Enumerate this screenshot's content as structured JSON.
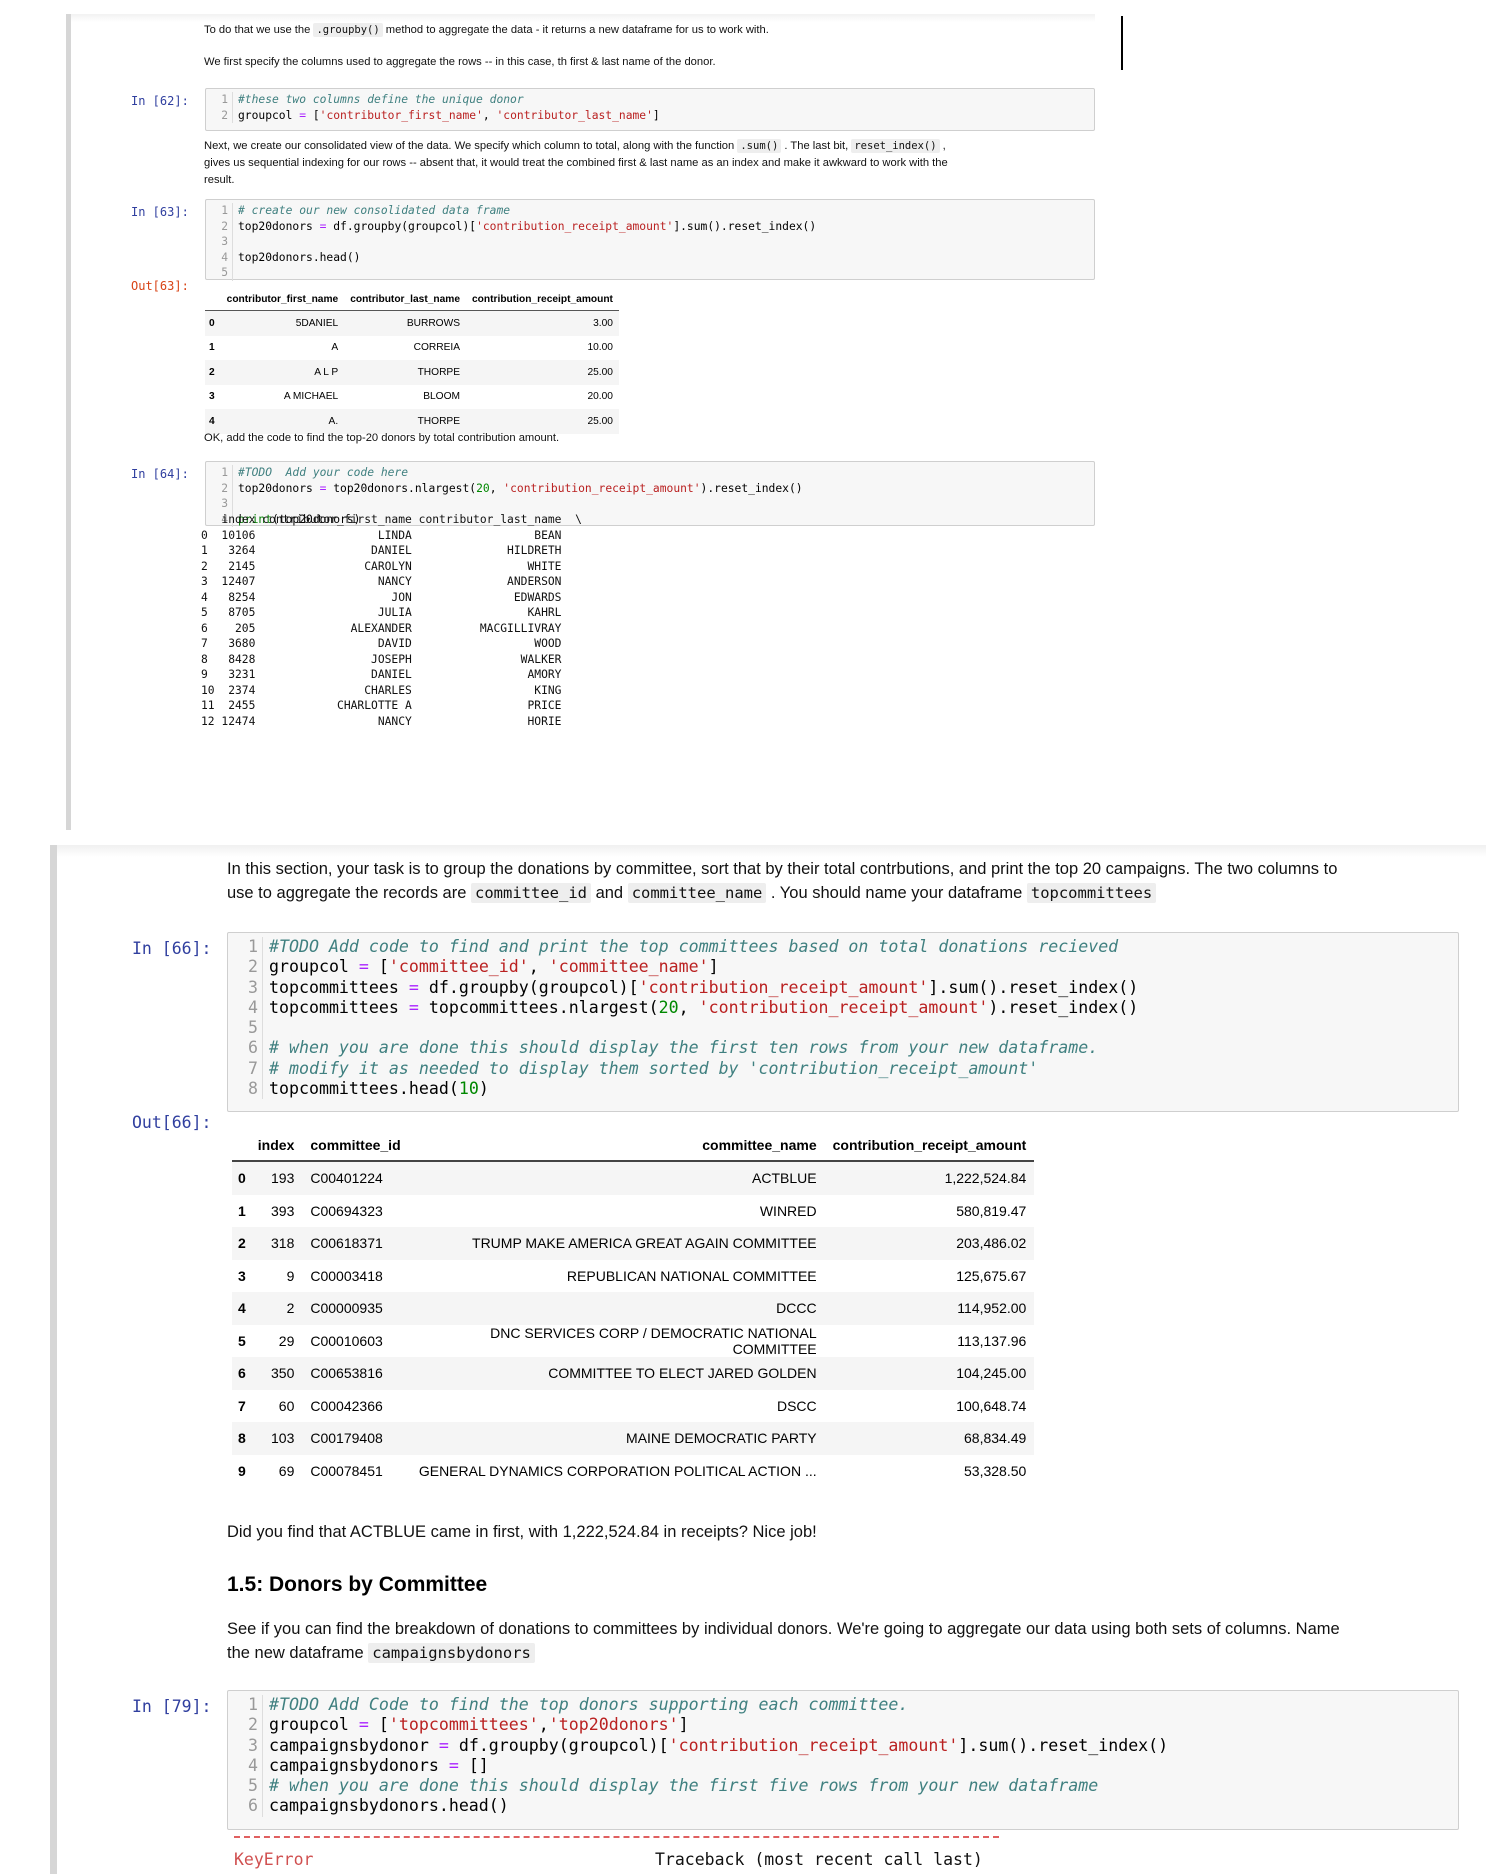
{
  "top_notebook": {
    "md1": {
      "pre": "To do that we use the ",
      "code": ".groupby()",
      "post": " method to aggregate the data - it returns a new dataframe for us to work with."
    },
    "md2": "We first specify the columns used to aggregate the rows -- in this case, th first & last name of the donor.",
    "cell62": {
      "prompt": "In [62]:",
      "lines": [
        {
          "n": "1",
          "comment": "#these two columns define the unique donor"
        },
        {
          "n": "2",
          "a": "groupcol ",
          "op": "=",
          "b": " [",
          "s1": "'contributor_first_name'",
          "c": ", ",
          "s2": "'contributor_last_name'",
          "d": "]"
        }
      ]
    },
    "md3": {
      "l1_pre": "Next, we create our consolidated view of the data. We specify which column to total, along with the function ",
      "l1_code": ".sum()",
      "l1_mid": " . The last bit, ",
      "l1_code2": "reset_index()",
      "l1_post": " ,",
      "l2": "gives us sequential indexing for our rows -- absent that, it would treat the combined first & last name as an index and make it awkward to work with the",
      "l3": "result."
    },
    "cell63": {
      "prompt": "In [63]:",
      "out_prompt": "Out[63]:",
      "line1_n": "1",
      "line1": "# create our new consolidated data frame",
      "line2_n": "2",
      "line2_a": "top20donors ",
      "line2_op": "=",
      "line2_b": " df.groupby(groupcol)[",
      "line2_s": "'contribution_receipt_amount'",
      "line2_c": "].sum().reset_index()",
      "line3_n": "3",
      "line4_n": "4",
      "line4": "top20donors.head()",
      "line5_n": "5",
      "table": {
        "columns": [
          "",
          "contributor_first_name",
          "contributor_last_name",
          "contribution_receipt_amount"
        ],
        "rows": [
          [
            "0",
            "5DANIEL",
            "BURROWS",
            "3.00"
          ],
          [
            "1",
            "A",
            "CORREIA",
            "10.00"
          ],
          [
            "2",
            "A L P",
            "THORPE",
            "25.00"
          ],
          [
            "3",
            "A MICHAEL",
            "BLOOM",
            "20.00"
          ],
          [
            "4",
            "A.",
            "THORPE",
            "25.00"
          ]
        ]
      }
    },
    "md4": "OK, add the code to find the top-20 donors by total contribution amount.",
    "cell64": {
      "prompt": "In [64]:",
      "line1_n": "1",
      "line1": "#TODO  Add your code here",
      "line2_n": "2",
      "line2_a": "top20donors ",
      "line2_op": "=",
      "line2_b": " top20donors.nlargest(",
      "line2_num": "20",
      "line2_c": ", ",
      "line2_s": "'contribution_receipt_amount'",
      "line2_d": ").reset_index()",
      "line3_n": "3",
      "line4_n": "4",
      "line4_fn": "print",
      "line4_rest": "(top20donors)",
      "print_output": "   index contributor_first_name contributor_last_name  \\\n0  10106                  LINDA                  BEAN\n1   3264                 DANIEL              HILDRETH\n2   2145                CAROLYN                 WHITE\n3  12407                  NANCY              ANDERSON\n4   8254                    JON               EDWARDS\n5   8705                  JULIA                 KAHRL\n6    205              ALEXANDER          MACGILLIVRAY\n7   3680                  DAVID                  WOOD\n8   8428                 JOSEPH                WALKER\n9   3231                 DANIEL                 AMORY\n10  2374                CHARLES                  KING\n11  2455            CHARLOTTE A                 PRICE\n12 12474                  NANCY                 HORIE"
    }
  },
  "bottom_notebook": {
    "md1": {
      "l1": "In this section, your task is to group the donations by committee, sort that by their total contrbutions, and print the top 20 campaigns. The two columns to",
      "l2_pre": "use to aggregate the records are ",
      "code1": "committee_id",
      "and": " and ",
      "code2": "committee_name",
      "l2_mid": " . You should name your dataframe ",
      "code3": "topcommittees"
    },
    "cell66": {
      "prompt": "In [66]:",
      "out_prompt": "Out[66]:",
      "l1": "#TODO Add code to find and print the top committees based on total donations recieved",
      "l2_a": "groupcol ",
      "l2_s1": "'committee_id'",
      "l2_s2": "'committee_name'",
      "l3_a": "topcommittees ",
      "l3_b": " df.groupby(groupcol)[",
      "l3_s": "'contribution_receipt_amount'",
      "l3_c": "].sum().reset_index()",
      "l4_a": "topcommittees ",
      "l4_b": " topcommittees.nlargest(",
      "l4_num": "20",
      "l4_s": "'contribution_receipt_amount'",
      "l4_c": ").reset_index()",
      "l6": "# when you are done this should display the first ten rows from your new dataframe.",
      "l7": "# modify it as needed to display them sorted by 'contribution_receipt_amount'",
      "l8_a": "topcommittees.head(",
      "l8_num": "10",
      "l8_c": ")",
      "nums": [
        "1",
        "2",
        "3",
        "4",
        "5",
        "6",
        "7",
        "8"
      ],
      "table": {
        "columns": [
          "",
          "index",
          "committee_id",
          "committee_name",
          "contribution_receipt_amount"
        ],
        "rows": [
          [
            "0",
            "193",
            "C00401224",
            "ACTBLUE",
            "1,222,524.84"
          ],
          [
            "1",
            "393",
            "C00694323",
            "WINRED",
            "580,819.47"
          ],
          [
            "2",
            "318",
            "C00618371",
            "TRUMP MAKE AMERICA GREAT AGAIN COMMITTEE",
            "203,486.02"
          ],
          [
            "3",
            "9",
            "C00003418",
            "REPUBLICAN NATIONAL COMMITTEE",
            "125,675.67"
          ],
          [
            "4",
            "2",
            "C00000935",
            "DCCC",
            "114,952.00"
          ],
          [
            "5",
            "29",
            "C00010603",
            "DNC SERVICES CORP / DEMOCRATIC NATIONAL COMMITTEE",
            "113,137.96"
          ],
          [
            "6",
            "350",
            "C00653816",
            "COMMITTEE TO ELECT JARED GOLDEN",
            "104,245.00"
          ],
          [
            "7",
            "60",
            "C00042366",
            "DSCC",
            "100,648.74"
          ],
          [
            "8",
            "103",
            "C00179408",
            "MAINE DEMOCRATIC PARTY",
            "68,834.49"
          ],
          [
            "9",
            "69",
            "C00078451",
            "GENERAL DYNAMICS CORPORATION POLITICAL ACTION ...",
            "53,328.50"
          ]
        ]
      }
    },
    "md2": "Did you find that ACTBLUE came in first, with 1,222,524.84 in receipts? Nice job!",
    "heading": "1.5: Donors by Committee",
    "md3": {
      "l1": "See if you can find the breakdown of donations to committees by individual donors. We're going to aggregate our data using both sets of columns. Name",
      "l2_pre": "the new dataframe ",
      "code": "campaignsbydonors"
    },
    "cell79": {
      "prompt": "In [79]:",
      "l1": "#TODO Add Code to find the top donors supporting each committee.",
      "l2_a": "groupcol ",
      "l2_s1": "'topcommittees'",
      "l2_s2": "'top20donors'",
      "l3_a": "campaignsbydonor ",
      "l3_b": " df.groupby(groupcol)[",
      "l3_s": "'contribution_receipt_amount'",
      "l3_c": "].sum().reset_index()",
      "l4_a": "campaignsbydonors ",
      "l4_b": " []",
      "l5": "# when you are done this should display the first five rows from your new dataframe",
      "l6": "campaignsbydonors.head()",
      "nums": [
        "1",
        "2",
        "3",
        "4",
        "5",
        "6"
      ],
      "error_name": "KeyError",
      "traceback_label": "Traceback (most recent call last)"
    }
  },
  "colors": {
    "prompt_in": "#303f9f",
    "prompt_out": "#d84315",
    "string": "#ba2121",
    "comment": "#408080",
    "number": "#008800",
    "error": "#e06060"
  }
}
